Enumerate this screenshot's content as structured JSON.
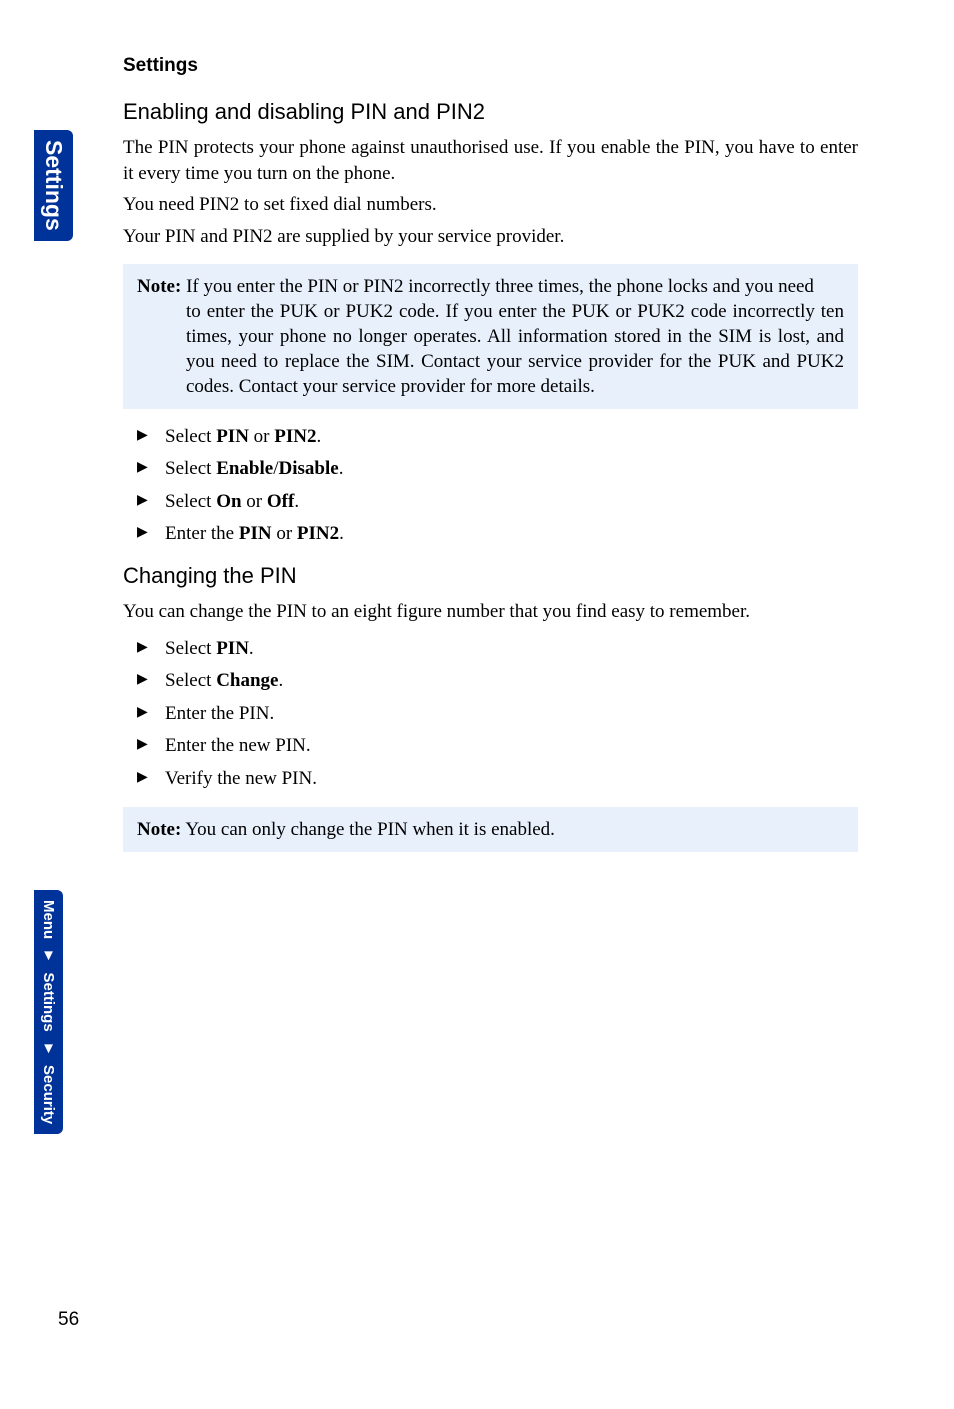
{
  "sidebar": {
    "tab1": "Settings",
    "crumb": {
      "a": "Menu",
      "b": "Settings",
      "c": "Security"
    }
  },
  "header": "Settings",
  "s1": {
    "title": "Enabling and disabling PIN and PIN2",
    "p1": "The PIN protects your phone against unauthorised use. If you enable the PIN, you have to enter it every time you turn on the phone.",
    "p2": "You need PIN2 to set fixed dial numbers.",
    "p3": "Your PIN and PIN2 are supplied by your service provider.",
    "noteLabel": "Note:",
    "noteLine1": " If you enter the PIN or PIN2 incorrectly three times, the phone locks and you need",
    "noteRest": "to enter the PUK or PUK2 code. If you enter the PUK or PUK2 code incorrectly ten times, your phone no longer operates. All information stored in the SIM is lost, and you need to replace the SIM. Contact your service provider for the PUK and PUK2 codes. Contact your service provider for more details.",
    "steps": {
      "l1a": "Select ",
      "l1b": "PIN",
      "l1c": " or ",
      "l1d": "PIN2",
      "l1e": ".",
      "l2a": "Select ",
      "l2b": "Enable",
      "l2c": "/",
      "l2d": "Disable",
      "l2e": ".",
      "l3a": "Select ",
      "l3b": "On",
      "l3c": " or ",
      "l3d": "Off",
      "l3e": ".",
      "l4a": "Enter the ",
      "l4b": "PIN",
      "l4c": " or ",
      "l4d": "PIN2",
      "l4e": "."
    }
  },
  "s2": {
    "title": "Changing the PIN",
    "p1": "You can change the PIN to an eight figure number that you find easy to remember.",
    "steps": {
      "l1a": "Select ",
      "l1b": "PIN",
      "l1c": ".",
      "l2a": "Select ",
      "l2b": "Change",
      "l2c": ".",
      "l3": "Enter the PIN.",
      "l4": "Enter the new PIN.",
      "l5": "Verify the new PIN."
    },
    "noteLabel": "Note:",
    "noteText": " You can only change the PIN when it is enabled."
  },
  "pageNumber": "56"
}
